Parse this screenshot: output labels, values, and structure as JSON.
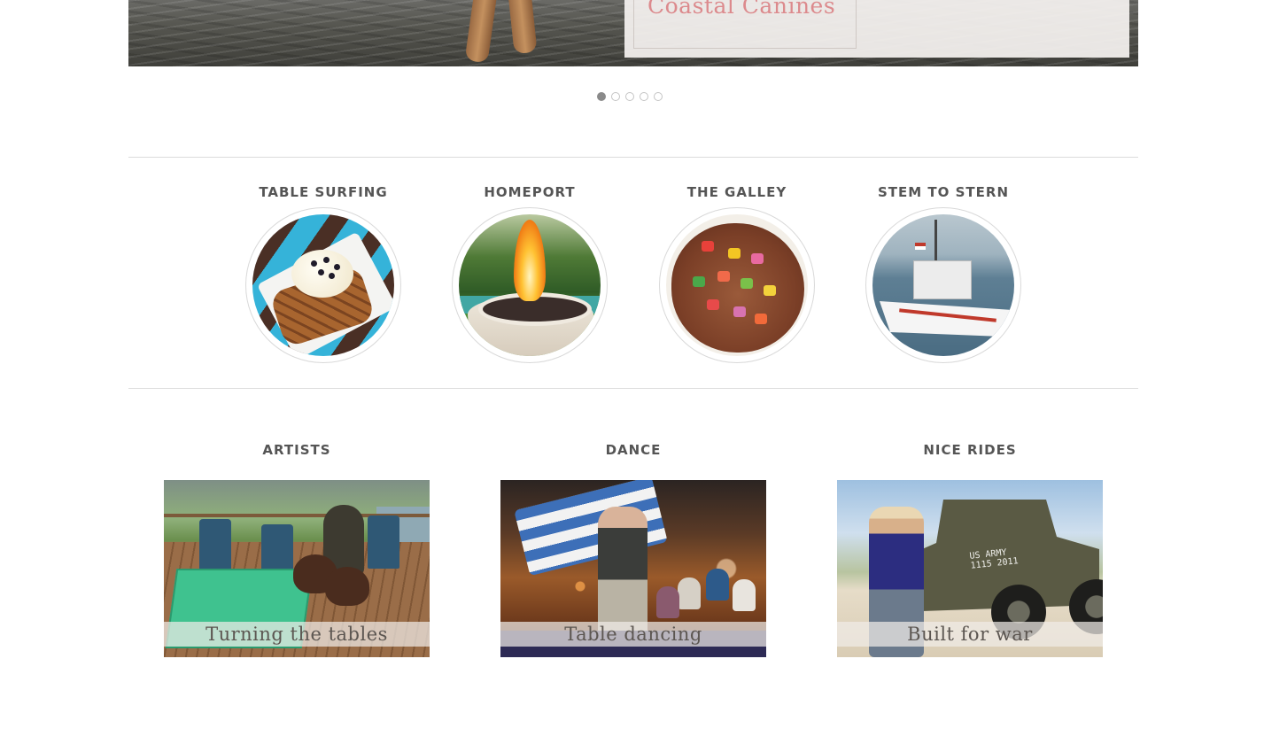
{
  "hero": {
    "caption_title": "Coastal Canines"
  },
  "carousel": {
    "slides": 5,
    "active_index": 0
  },
  "featured": [
    {
      "title": "TABLE SURFING",
      "image": "waffle-dessert-photo"
    },
    {
      "title": "HOMEPORT",
      "image": "fire-bowl-photo"
    },
    {
      "title": "THE GALLEY",
      "image": "salsa-dish-photo"
    },
    {
      "title": "STEM TO STERN",
      "image": "boat-photo"
    }
  ],
  "cards": [
    {
      "title": "ARTISTS",
      "caption": "Turning the tables",
      "image": "deck-with-dogs-photo"
    },
    {
      "title": "DANCE",
      "caption": "Table dancing",
      "image": "restaurant-dancer-photo"
    },
    {
      "title": "NICE RIDES",
      "caption": "Built for war",
      "image": "army-jeep-photo"
    }
  ],
  "jeep_marking": [
    "US ARMY",
    "1115 2011"
  ],
  "colors": {
    "accent_caption": "#dc8a8d",
    "heading": "#555555",
    "divider": "#dcdcdc",
    "dot_active": "#8a8a8a",
    "dot_inactive": "#c4c4c4"
  }
}
